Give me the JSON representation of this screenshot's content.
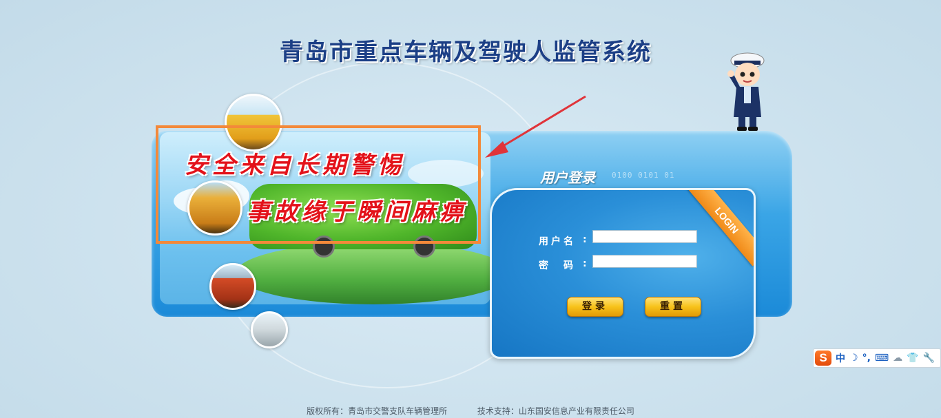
{
  "header": {
    "title": "青岛市重点车辆及驾驶人监管系统"
  },
  "banner": {
    "slogan_1": "安全来自长期警惕",
    "slogan_2": "事故缘于瞬间麻痹"
  },
  "login": {
    "heading": "用户登录",
    "binary_text": "0100 0101 01",
    "ribbon": "LOGIN",
    "username_label": "用户名",
    "password_label": "密　码",
    "username_value": "",
    "password_value": "",
    "login_button": "登录",
    "reset_button": "重置"
  },
  "ime": {
    "logo": "S",
    "mode": "中",
    "items": [
      "☽",
      "°,",
      "⌨",
      "☁",
      "👕",
      "🔧"
    ]
  },
  "footer": {
    "copyright": "版权所有：青岛市交警支队车辆管理所",
    "support": "技术支持：山东国安信息产业有限责任公司"
  },
  "colors": {
    "title": "#1c3f86",
    "slogan": "#e3121a",
    "highlight": "#f3893a",
    "panel": "#2a8fd8",
    "button": "#f7c21a"
  }
}
